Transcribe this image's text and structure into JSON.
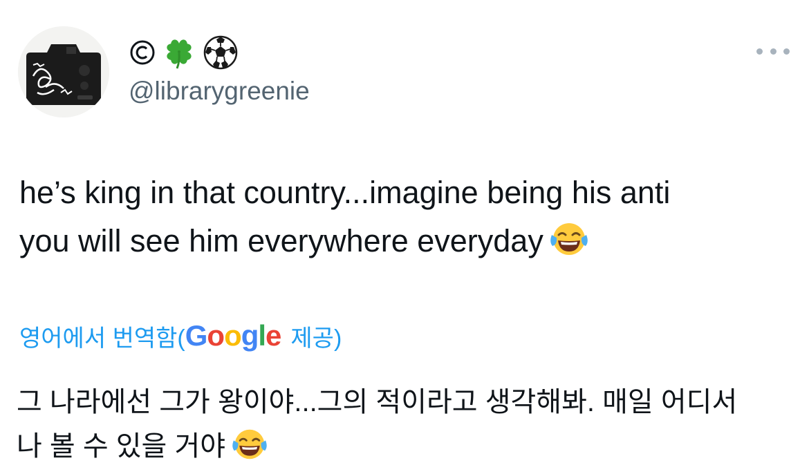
{
  "author": {
    "display_name_icons": [
      "copyright-symbol",
      "four-leaf-clover-emoji",
      "soccer-ball-emoji"
    ],
    "copyright_glyph": "©",
    "handle": "@librarygreenie"
  },
  "tweet": {
    "text_line_1": "he’s king in that country...imagine being his anti",
    "text_line_2": "you will see him everywhere everyday",
    "emoji": "tears-of-joy-emoji"
  },
  "translation": {
    "prefix": "영어에서 번역함(",
    "brand": [
      "G",
      "o",
      "o",
      "g",
      "l",
      "e"
    ],
    "suffix": "제공)",
    "text_line_1": "그 나라에선 그가 왕이야...그의 적이라고 생각해봐. 매일 어디서",
    "text_line_2": "나 볼 수 있을 거야",
    "emoji": "tears-of-joy-emoji"
  },
  "colors": {
    "link_blue": "#1d9bf0",
    "handle_gray": "#536471",
    "text": "#0f1419"
  }
}
